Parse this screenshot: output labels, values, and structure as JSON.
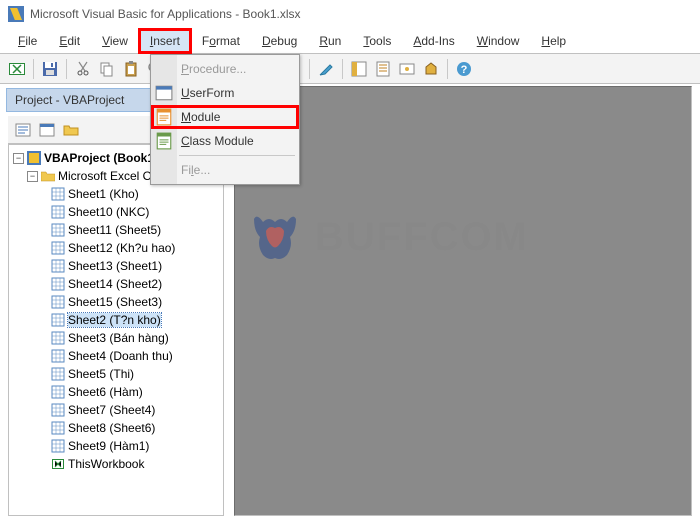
{
  "window": {
    "title": "Microsoft Visual Basic for Applications - Book1.xlsx"
  },
  "menubar": {
    "file": "File",
    "file_u": "F",
    "edit": "Edit",
    "edit_u": "E",
    "view": "View",
    "view_u": "V",
    "insert": "Insert",
    "insert_u": "I",
    "format": "Format",
    "format_u": "o",
    "debug": "Debug",
    "debug_u": "D",
    "run": "Run",
    "run_u": "R",
    "tools": "Tools",
    "tools_u": "T",
    "addins": "Add-Ins",
    "addins_u": "A",
    "window": "Window",
    "window_u": "W",
    "help": "Help",
    "help_u": "H"
  },
  "dropdown": {
    "procedure": "Procedure...",
    "procedure_u": "P",
    "userform": "UserForm",
    "userform_u": "U",
    "module": "Module",
    "module_u": "M",
    "classmodule": "Class Module",
    "classmodule_u": "C",
    "file": "File...",
    "file_u": "l"
  },
  "project": {
    "pane_title": "Project - VBAProject",
    "root": "VBAProject (Book1)",
    "folder": "Microsoft Excel Objects",
    "sheets": [
      "Sheet1 (Kho)",
      "Sheet10 (NKC)",
      "Sheet11 (Sheet5)",
      "Sheet12 (Kh?u hao)",
      "Sheet13 (Sheet1)",
      "Sheet14 (Sheet2)",
      "Sheet15 (Sheet3)",
      "Sheet2 (T?n kho)",
      "Sheet3 (Bán hàng)",
      "Sheet4 (Doanh thu)",
      "Sheet5 (Thi)",
      "Sheet6 (Hàm)",
      "Sheet7 (Sheet4)",
      "Sheet8 (Sheet6)",
      "Sheet9 (Hàm1)"
    ],
    "thisworkbook": "ThisWorkbook"
  },
  "watermark": {
    "text": "BUFFCOM"
  }
}
